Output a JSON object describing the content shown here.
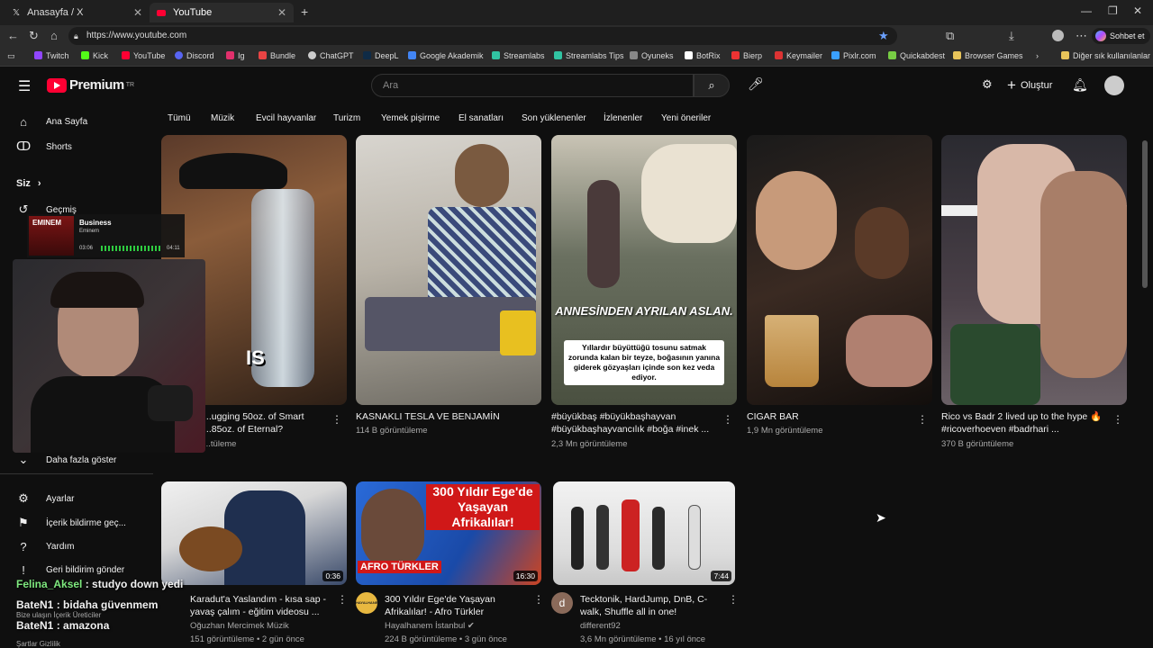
{
  "browser": {
    "tabs": [
      {
        "label": "Anasayfa / X"
      },
      {
        "label": "YouTube"
      }
    ],
    "url": "https://www.youtube.com",
    "chat_button": "Sohbet et",
    "bookmarks": [
      "Twitch",
      "Kick",
      "YouTube",
      "Discord",
      "Ig",
      "Bundle",
      "ChatGPT",
      "DeepL",
      "Google Akademik",
      "Streamlabs",
      "Streamlabs Tips",
      "Oyuneks",
      "BotRix",
      "Bierp",
      "Keymailer",
      "Pixlr.com",
      "Quickabdest",
      "Browser Games"
    ],
    "other_bookmarks": "Diğer sık kullanılanlar"
  },
  "youtube": {
    "logo_text": "Premium",
    "logo_sup": "TR",
    "search_placeholder": "Ara",
    "create_label": "Oluştur",
    "chips": [
      "Tümü",
      "Müzik",
      "Evcil hayvanlar",
      "Turizm",
      "Yemek pişirme",
      "El sanatları",
      "Son yüklenenler",
      "İzlenenler",
      "Yeni öneriler"
    ],
    "sidebar": {
      "home": "Ana Sayfa",
      "shorts": "Shorts",
      "you": "Siz",
      "history": "Geçmiş",
      "show_more": "Daha fazla göster",
      "settings": "Ayarlar",
      "report": "İçerik bildirme geç...",
      "help": "Yardım",
      "feedback": "Geri bildirim gönder",
      "footer1": "Bize ulaşın  İçerik Üreticiler",
      "footer2": "Şartlar  Gizlilik"
    },
    "row1": [
      {
        "title_l1": "...ugging 50oz. of Smart",
        "title_l2": "...85oz. of Eternal?",
        "meta": "...tüleme",
        "overlay": "IS"
      },
      {
        "title_l1": "KASNAKLI TESLA VE BENJAMİN",
        "title_l2": "",
        "meta": "114 B görüntüleme"
      },
      {
        "title_l1": "#büyükbaş #büyükbaşhayvan",
        "title_l2": "#büyükbaşhayvancılık #boğa #inek ...",
        "meta": "2,3 Mn görüntüleme",
        "overlay_title": "ANNESİNDEN AYRILAN ASLAN.",
        "overlay_text": "Yıllardır büyüttüğü tosunu satmak zorunda kalan bir teyze, boğasının yanına giderek gözyaşları içinde son kez veda ediyor."
      },
      {
        "title_l1": "CIGAR BAR",
        "title_l2": "",
        "meta": "1,9 Mn görüntüleme"
      },
      {
        "title_l1": "Rico vs Badr 2 lived up to the hype 🔥",
        "title_l2": "#ricoverhoeven #badrhari ...",
        "meta": "370 B görüntüleme"
      }
    ],
    "row2": [
      {
        "title_l1": "Karadut'a Yaslandım - kısa sap -",
        "title_l2": "yavaş çalım - eğitim videosu ...",
        "channel": "Oğuzhan Mercimek Müzik",
        "meta": "151 görüntüleme • 2 gün önce",
        "duration": "0:36"
      },
      {
        "title_l1": "300 Yıldır Ege'de Yaşayan",
        "title_l2": "Afrikalılar! - Afro Türkler",
        "channel": "Hayalhanem İstanbul",
        "meta": "224 B görüntüleme • 3 gün önce",
        "duration": "16:30",
        "overlay_top": "300 Yıldır Ege'de Yaşayan Afrikalılar!",
        "overlay_bottom": "AFRO TÜRKLER",
        "avatar_letter": "HAYALHANEM"
      },
      {
        "title_l1": "Tecktonik, HardJump, DnB, C-",
        "title_l2": "walk, Shuffle all in one!",
        "channel": "different92",
        "meta": "3,6 Mn görüntüleme • 16 yıl önce",
        "duration": "7:44",
        "avatar_letter": "d"
      }
    ]
  },
  "stream_overlay": {
    "music_title": "Business",
    "music_artist": "Eminem",
    "album_text": "EMINEM",
    "time_current": "03:06",
    "time_total": "04:11",
    "chat": [
      {
        "user": "Felina_Aksel",
        "msg": " : studyo down yedi",
        "color": "#7ee87e"
      },
      {
        "user": "BateN1",
        "msg": " : bidaha güvenmem",
        "color": "#ffffff"
      },
      {
        "user": "BateN1",
        "msg": " : amazona",
        "color": "#ffffff"
      }
    ]
  }
}
